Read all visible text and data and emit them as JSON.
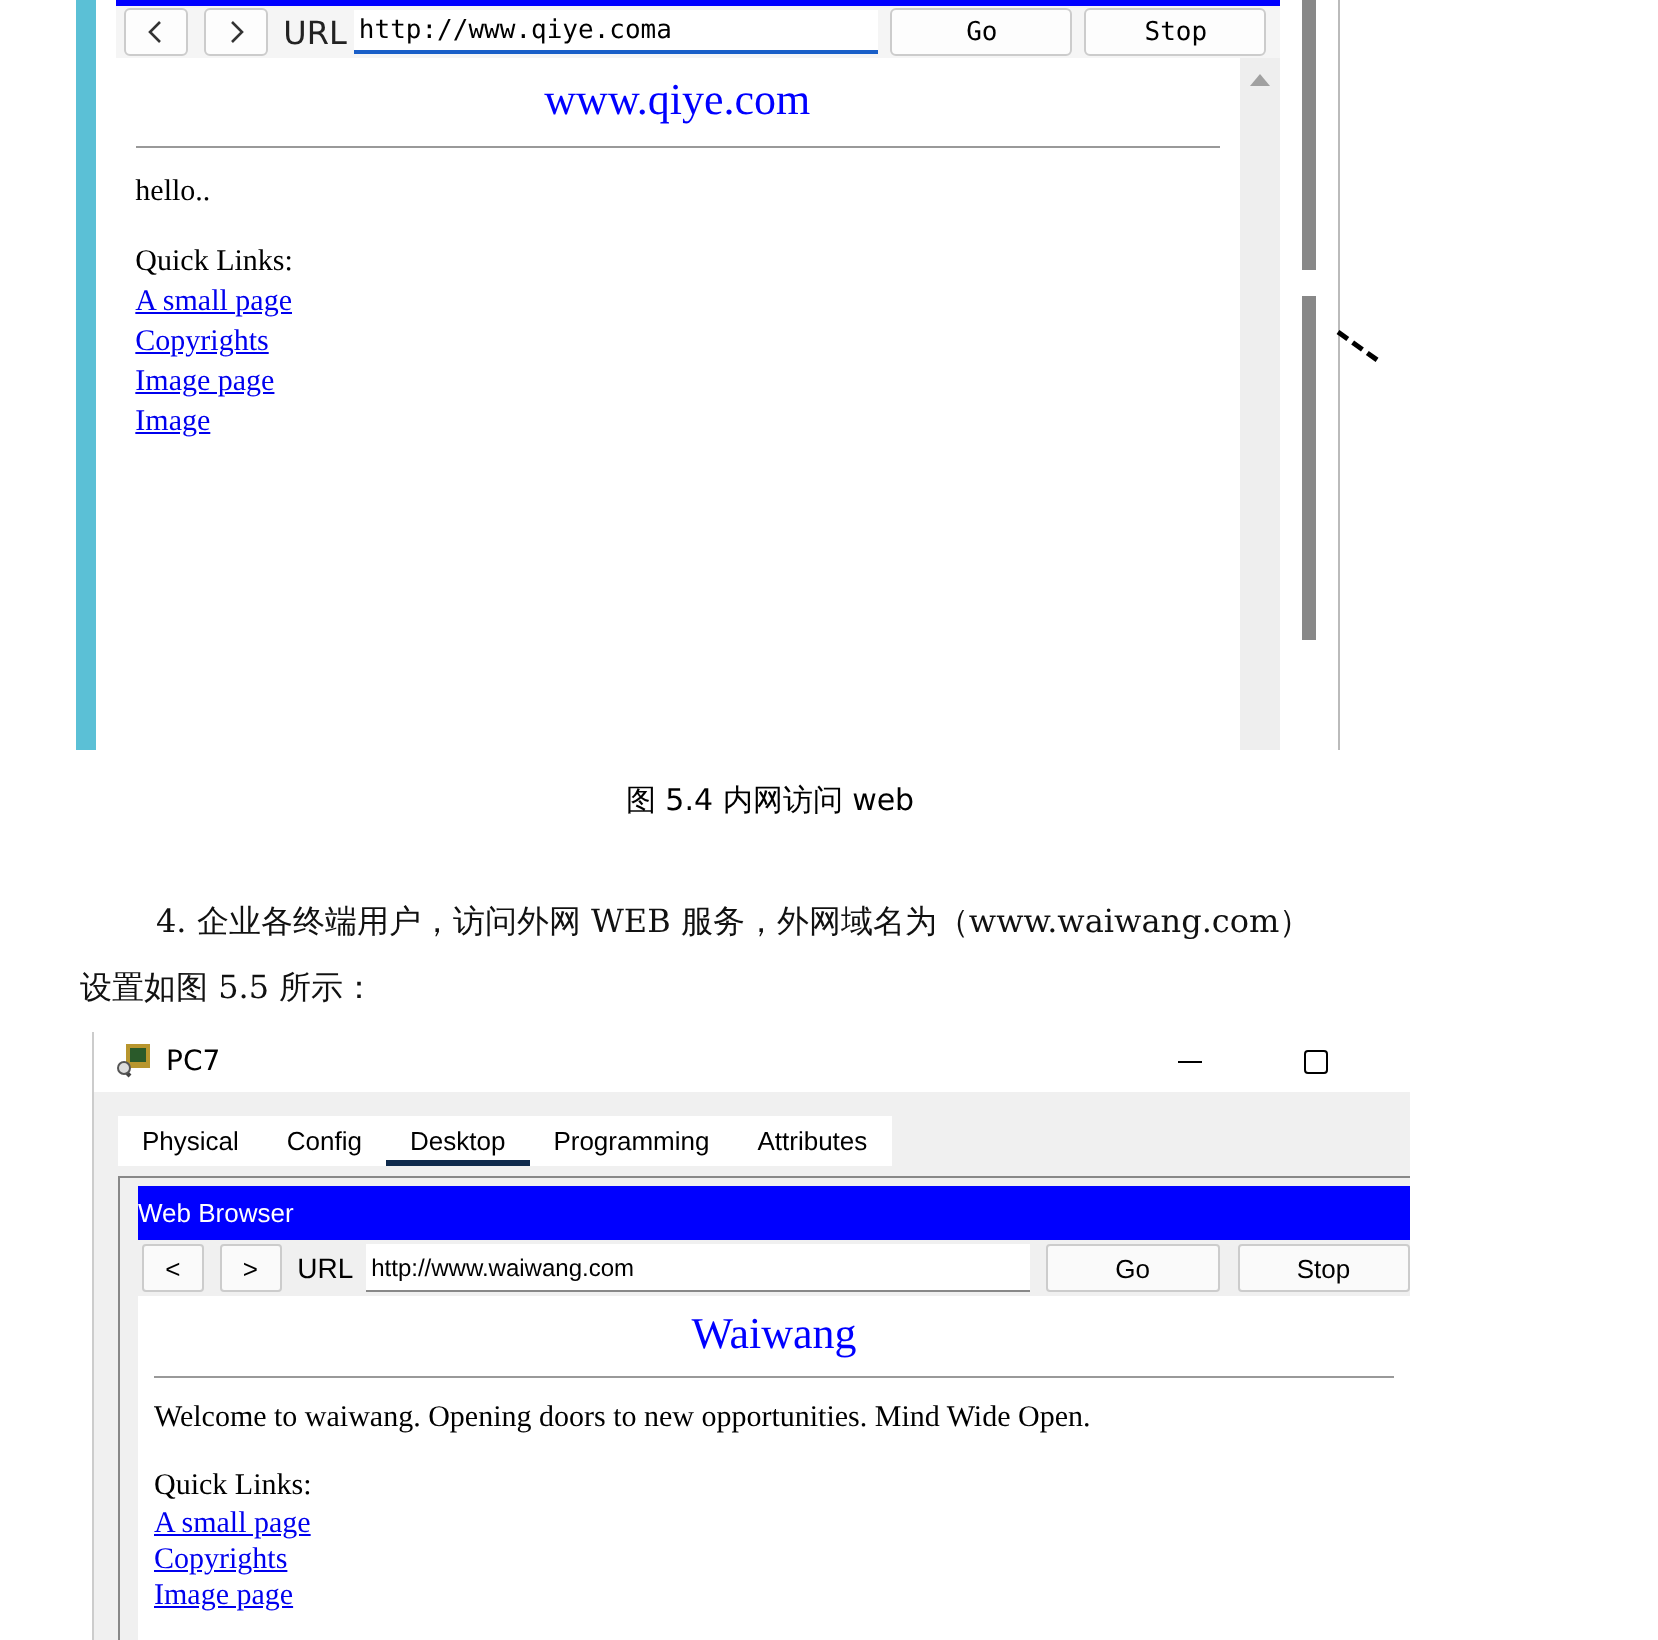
{
  "figure_1": {
    "url_label": "URL",
    "url_value": "http://www.qiye.coma",
    "go_button": "Go",
    "stop_button": "Stop",
    "page": {
      "heading": "www.qiye.com",
      "text": "hello..",
      "links_heading": "Quick Links:",
      "links": [
        "A small page",
        "Copyrights",
        "Image page",
        "Image"
      ]
    }
  },
  "caption": "图 5.4 内网访问 web",
  "paragraph": [
    "4. 企业各终端用户，访问外网 WEB 服务，外网域名为（www.waiwang.com）",
    "设置如图 5.5 所示："
  ],
  "figure_2": {
    "window_title": "PC7",
    "tabs": [
      {
        "label": "Physical",
        "selected": false
      },
      {
        "label": "Config",
        "selected": false
      },
      {
        "label": "Desktop",
        "selected": true
      },
      {
        "label": "Programming",
        "selected": false
      },
      {
        "label": "Attributes",
        "selected": false
      }
    ],
    "app_title": "Web Browser",
    "back_button": "<",
    "forward_button": ">",
    "url_label": "URL",
    "url_value": "http://www.waiwang.com",
    "go_button": "Go",
    "stop_button": "Stop",
    "page": {
      "heading": "Waiwang",
      "text": "Welcome to waiwang. Opening doors to new opportunities. Mind Wide Open.",
      "links_heading": "Quick Links:",
      "links": [
        "A small page",
        "Copyrights",
        "Image page"
      ]
    }
  }
}
